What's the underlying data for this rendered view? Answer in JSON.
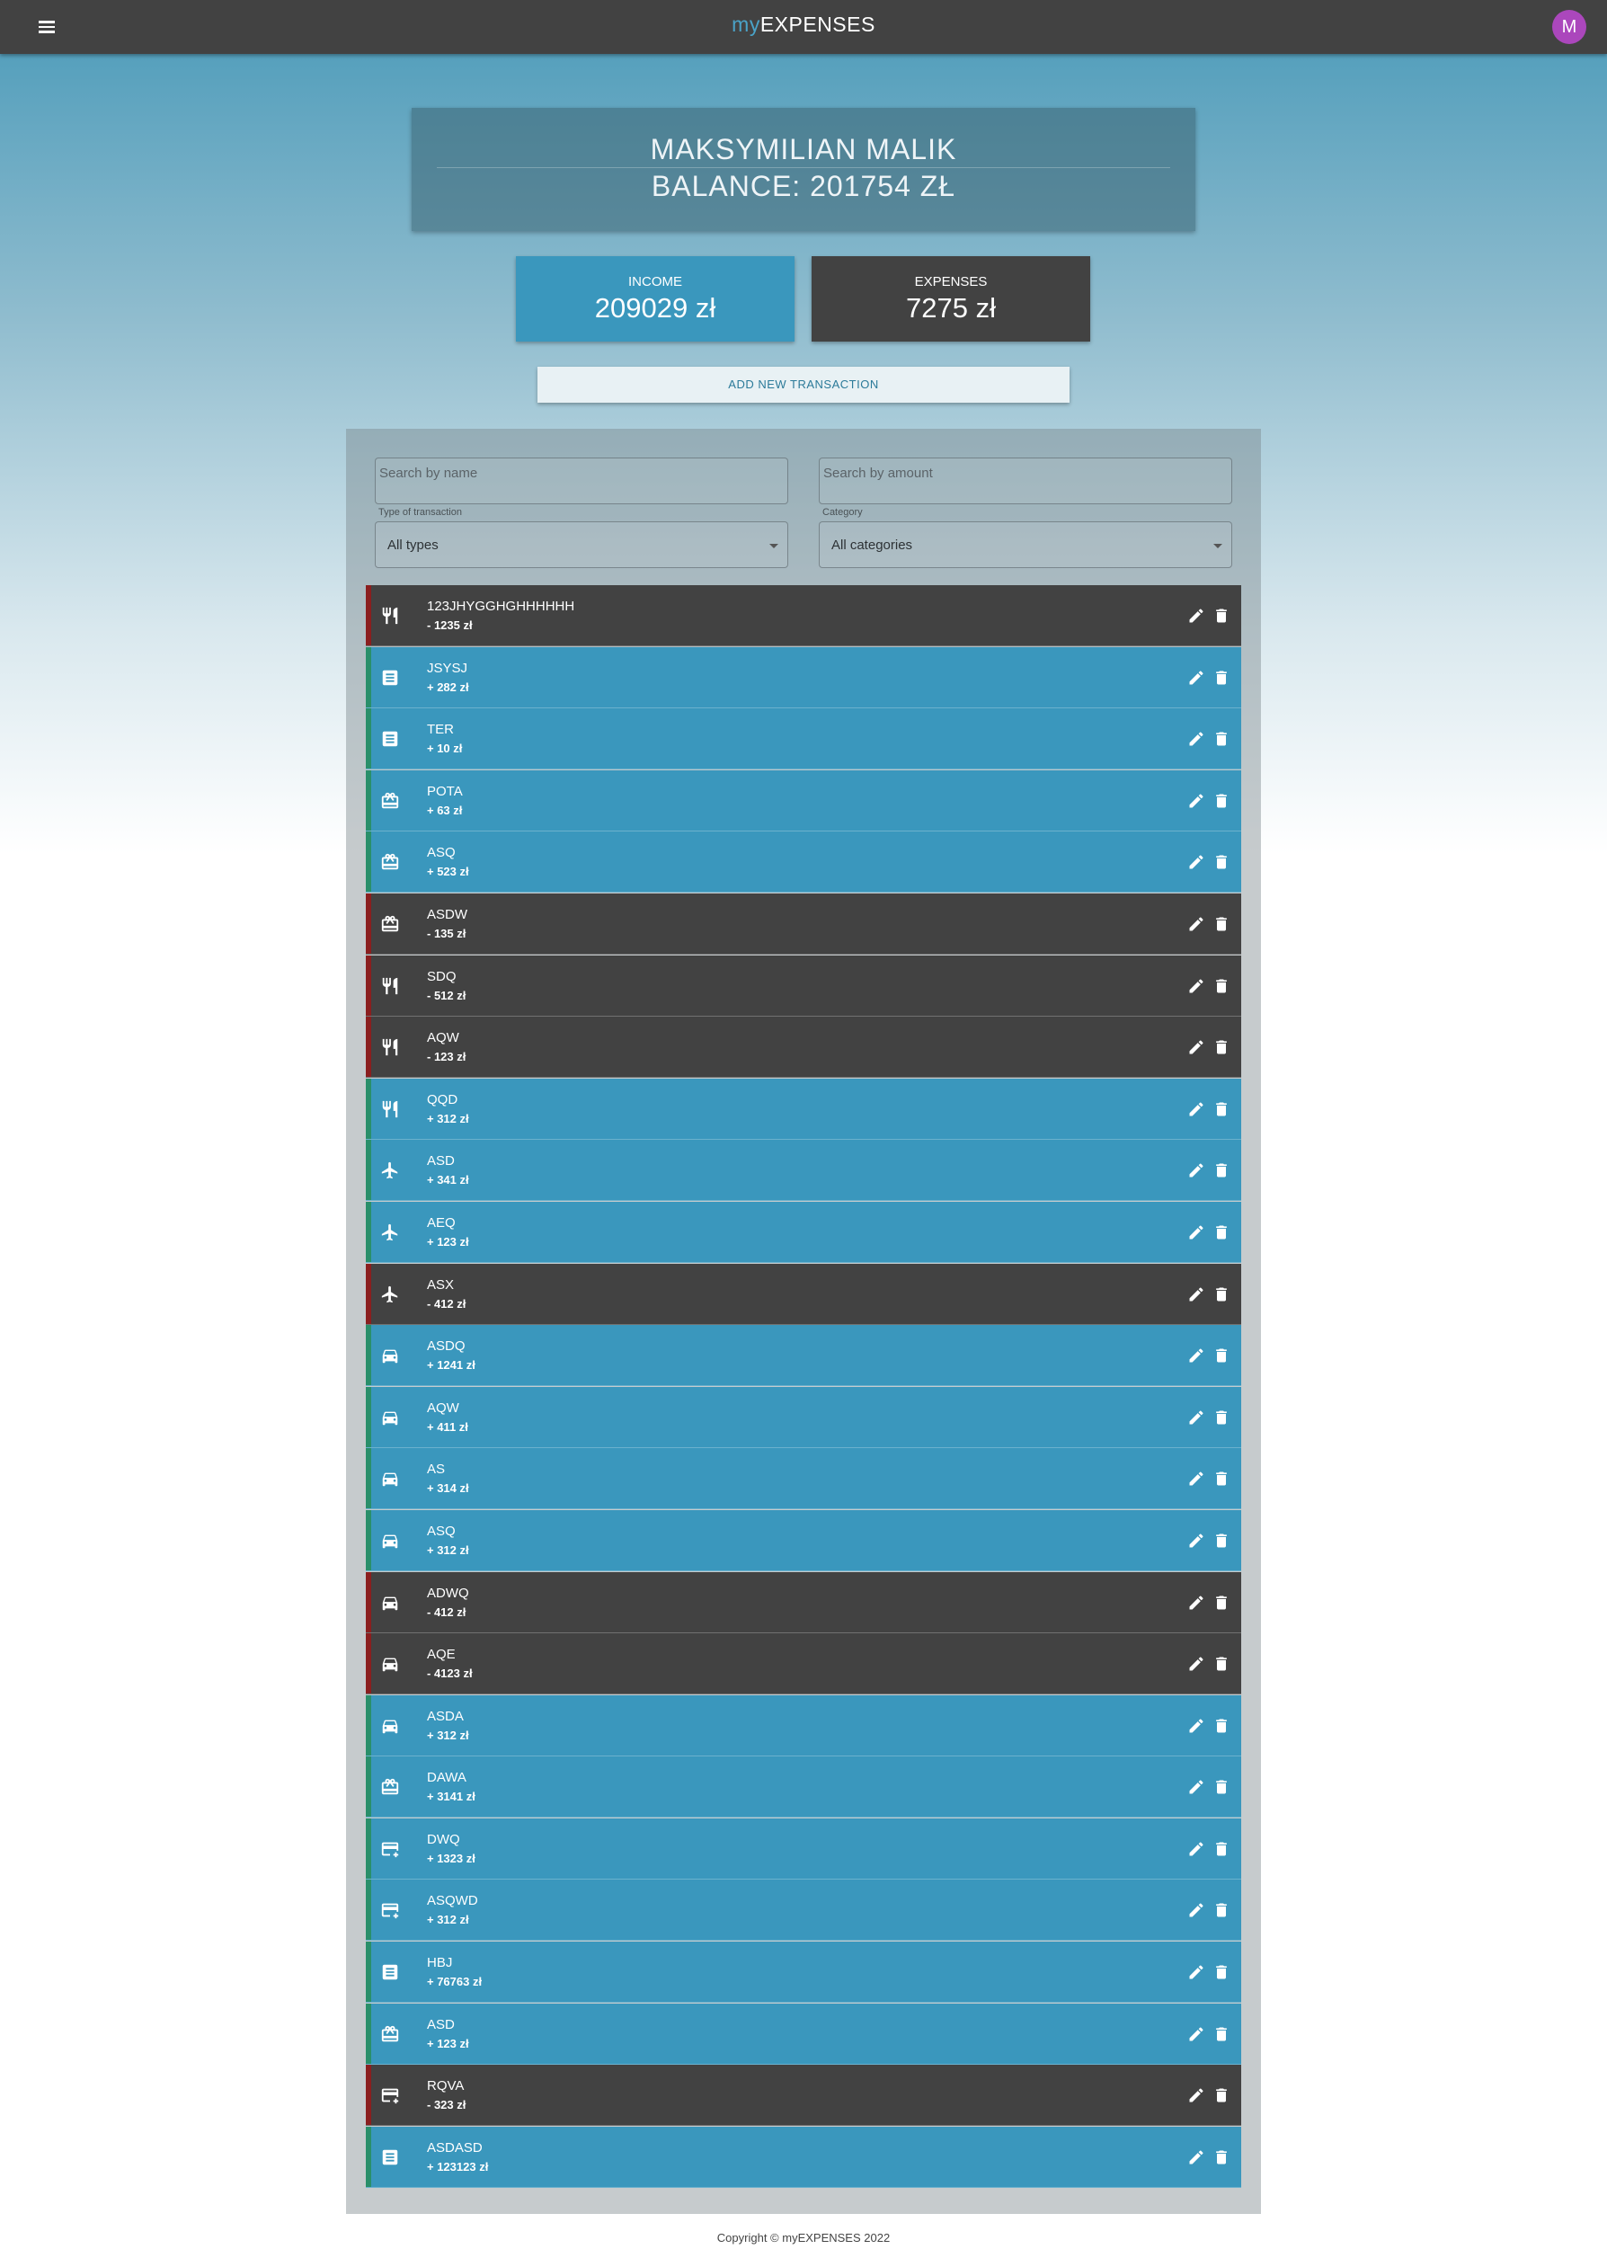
{
  "app": {
    "logo_prefix": "my",
    "logo_main": "EXPENSES",
    "avatar_letter": "M"
  },
  "header": {
    "name": "MAKSYMILIAN MALIK",
    "balance": "BALANCE: 201754 ZŁ"
  },
  "stats": {
    "income_label": "INCOME",
    "income_value": "209029 zł",
    "expenses_label": "EXPENSES",
    "expenses_value": "7275 zł"
  },
  "add_button": "ADD NEW TRANSACTION",
  "filters": {
    "search_name_placeholder": "Search by name",
    "search_amount_placeholder": "Search by amount",
    "type_label": "Type of transaction",
    "type_value": "All types",
    "category_label": "Category",
    "category_value": "All categories"
  },
  "transactions": [
    {
      "name": "123JHYGGHGHHHHHH",
      "amount": "- 1235 zł",
      "kind": "expense",
      "icon": "restaurant-icon"
    },
    {
      "name": "JSYSJ",
      "amount": "+ 282 zł",
      "kind": "income",
      "icon": "receipt-icon"
    },
    {
      "name": "TER",
      "amount": "+ 10 zł",
      "kind": "income",
      "icon": "receipt-icon"
    },
    {
      "name": "POTA",
      "amount": "+ 63 zł",
      "kind": "income",
      "icon": "gift-icon"
    },
    {
      "name": "ASQ",
      "amount": "+ 523 zł",
      "kind": "income",
      "icon": "gift-icon"
    },
    {
      "name": "ASDW",
      "amount": "- 135 zł",
      "kind": "expense",
      "icon": "gift-icon"
    },
    {
      "name": "SDQ",
      "amount": "- 512 zł",
      "kind": "expense",
      "icon": "restaurant-icon"
    },
    {
      "name": "AQW",
      "amount": "- 123 zł",
      "kind": "expense",
      "icon": "restaurant-icon"
    },
    {
      "name": "QQD",
      "amount": "+ 312 zł",
      "kind": "income",
      "icon": "restaurant-icon"
    },
    {
      "name": "ASD",
      "amount": "+ 341 zł",
      "kind": "income",
      "icon": "airplane-icon"
    },
    {
      "name": "AEQ",
      "amount": "+ 123 zł",
      "kind": "income",
      "icon": "airplane-icon"
    },
    {
      "name": "ASX",
      "amount": "- 412 zł",
      "kind": "expense",
      "icon": "airplane-icon"
    },
    {
      "name": "ASDQ",
      "amount": "+ 1241 zł",
      "kind": "income",
      "icon": "car-icon"
    },
    {
      "name": "AQW",
      "amount": "+ 411 zł",
      "kind": "income",
      "icon": "car-icon"
    },
    {
      "name": "AS",
      "amount": "+ 314 zł",
      "kind": "income",
      "icon": "car-icon"
    },
    {
      "name": "ASQ",
      "amount": "+ 312 zł",
      "kind": "income",
      "icon": "car-icon"
    },
    {
      "name": "ADWQ",
      "amount": "- 412 zł",
      "kind": "expense",
      "icon": "car-icon"
    },
    {
      "name": "AQE",
      "amount": "- 4123 zł",
      "kind": "expense",
      "icon": "car-icon"
    },
    {
      "name": "ASDA",
      "amount": "+ 312 zł",
      "kind": "income",
      "icon": "car-icon"
    },
    {
      "name": "DAWA",
      "amount": "+ 3141 zł",
      "kind": "income",
      "icon": "gift-icon"
    },
    {
      "name": "DWQ",
      "amount": "+ 1323 zł",
      "kind": "income",
      "icon": "credit-card-plus-icon"
    },
    {
      "name": "ASQWD",
      "amount": "+ 312 zł",
      "kind": "income",
      "icon": "credit-card-plus-icon"
    },
    {
      "name": "HBJ",
      "amount": "+ 76763 zł",
      "kind": "income",
      "icon": "receipt-icon"
    },
    {
      "name": "ASD",
      "amount": "+ 123 zł",
      "kind": "income",
      "icon": "gift-icon"
    },
    {
      "name": "RQVA",
      "amount": "- 323 zł",
      "kind": "expense",
      "icon": "credit-card-plus-icon"
    },
    {
      "name": "ASDASD",
      "amount": "+ 123123 zł",
      "kind": "income",
      "icon": "receipt-icon"
    }
  ],
  "footer": "Copyright © myEXPENSES 2022"
}
